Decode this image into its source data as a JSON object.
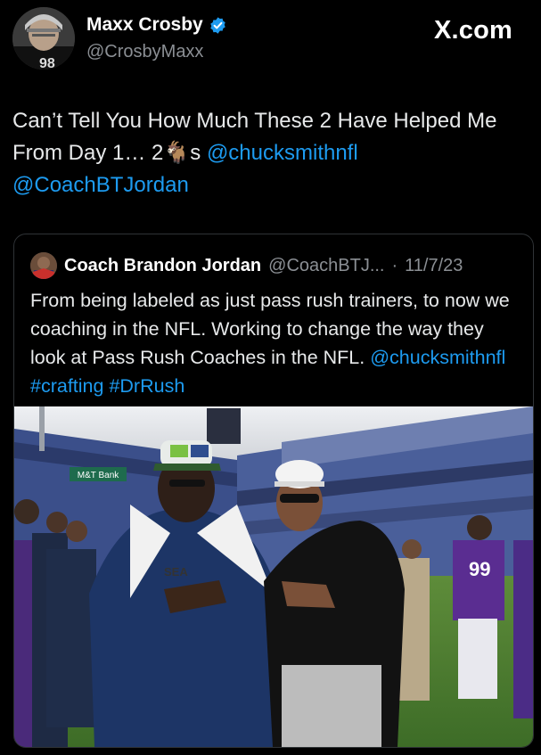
{
  "author": {
    "display_name": "Maxx Crosby",
    "handle": "@CrosbyMaxx",
    "verified": true
  },
  "site": {
    "logo": "X.com"
  },
  "tweet": {
    "text_part1": "Can’t Tell You How Much These 2 Have Helped Me From Day 1… 2",
    "emoji": "🐐",
    "text_part2": "s ",
    "mention1": "@chucksmithnfl",
    "mention2": "@CoachBTJordan"
  },
  "quoted": {
    "display_name": "Coach Brandon Jordan",
    "handle": "@CoachBTJ...",
    "separator": "·",
    "date": "11/7/23",
    "text": "From being labeled as just pass rush trainers, to now we coaching in the NFL. Working to change the way they look at Pass Rush Coaches in the NFL.",
    "tags": [
      "@chucksmithnfl",
      "#crafting",
      "#DrRush"
    ],
    "photo_texts": {
      "banner": "M&T Bank",
      "jersey": "99"
    }
  },
  "colors": {
    "background": "#000000",
    "link": "#1d9bf0",
    "verified": "#1d9bf0",
    "border": "#2f3336"
  },
  "icons": [
    "verified-badge-icon",
    "goat-emoji-icon"
  ]
}
